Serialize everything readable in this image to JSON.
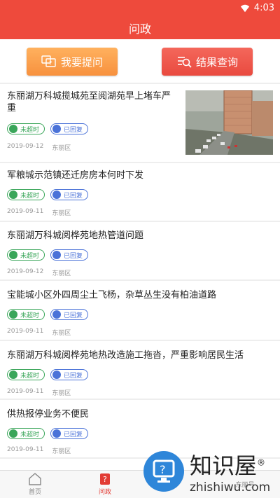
{
  "status_bar": {
    "time": "4:03"
  },
  "header": {
    "title": "问政"
  },
  "actions": {
    "ask_label": "我要提问",
    "query_label": "结果查询"
  },
  "items": [
    {
      "title": "东丽湖万科城揽城苑至阅湖苑早上堵车严重",
      "tag1": "未超时",
      "tag2": "已回复",
      "date": "2019-09-12",
      "district": "东丽区"
    },
    {
      "title": "军粮城示范镇还迁房房本何时下发",
      "tag1": "未超时",
      "tag2": "已回复",
      "date": "2019-09-11",
      "district": "东丽区"
    },
    {
      "title": "东丽湖万科城阅桦苑地热管道问题",
      "tag1": "未超时",
      "tag2": "已回复",
      "date": "2019-09-12",
      "district": "东丽区"
    },
    {
      "title": "宝能城小区外四周尘土飞杨，杂草丛生没有柏油道路",
      "tag1": "未超时",
      "tag2": "已回复",
      "date": "2019-09-11",
      "district": "东丽区"
    },
    {
      "title": "东丽湖万科城阅桦苑地热改造施工拖沓，严重影响居民生活",
      "tag1": "未超时",
      "tag2": "已回复",
      "date": "2019-09-11",
      "district": "东丽区"
    },
    {
      "title": "供热报停业务不便民",
      "tag1": "未超时",
      "tag2": "已回复",
      "date": "2019-09-11",
      "district": "东丽区"
    }
  ],
  "bottom_nav": [
    {
      "label": "首页"
    },
    {
      "label": "问政"
    },
    {
      "label": ""
    },
    {
      "label": "东丽号"
    }
  ],
  "watermark": {
    "brand_cn": "知识屋",
    "brand_en": "zhishiwu.com",
    "mark": "®"
  }
}
